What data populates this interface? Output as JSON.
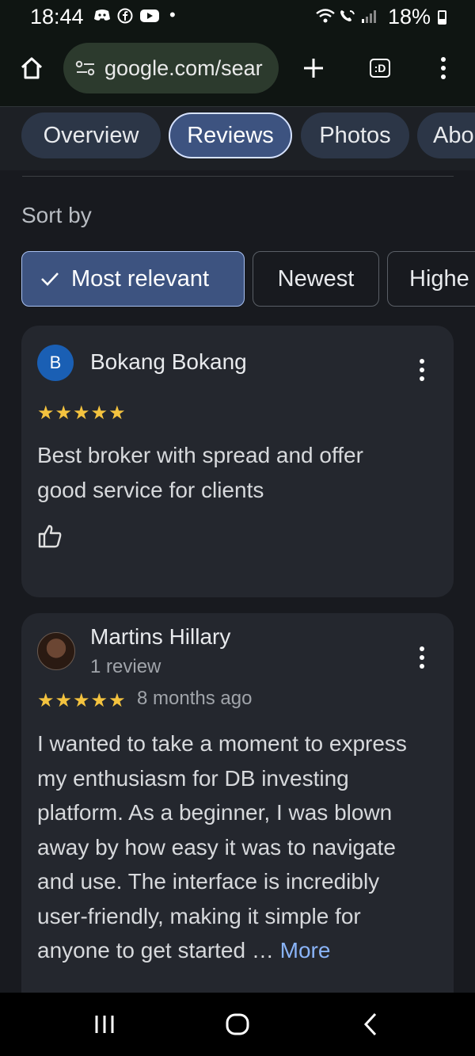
{
  "status_bar": {
    "time": "18:44",
    "battery_percent": "18%"
  },
  "browser": {
    "url": "google.com/sear",
    "tab_count": ":D"
  },
  "tabs": [
    {
      "label": "Overview",
      "active": false
    },
    {
      "label": "Reviews",
      "active": true
    },
    {
      "label": "Photos",
      "active": false
    },
    {
      "label": "Abo",
      "active": false
    }
  ],
  "sort": {
    "label": "Sort by",
    "options": [
      {
        "label": "Most relevant",
        "selected": true
      },
      {
        "label": "Newest",
        "selected": false
      },
      {
        "label": "Highe",
        "selected": false
      }
    ]
  },
  "reviews": [
    {
      "author": "Bokang Bokang",
      "avatar_letter": "B",
      "rating": 5,
      "stars": "★★★★★",
      "text_lines": [
        "Best broker with spread and offer",
        "good service for clients"
      ]
    },
    {
      "author": "Martins Hillary",
      "review_count": "1 review",
      "rating": 5,
      "stars": "★★★★★",
      "date": "8 months ago",
      "text_lines": [
        "I wanted to take a moment to express",
        "my enthusiasm for DB investing",
        "platform. As a beginner, I was blown",
        "away by how easy it was to navigate",
        "and use. The interface is incredibly",
        "user-friendly, making it simple for",
        "anyone to get started …"
      ],
      "more_label": "More"
    }
  ],
  "colors": {
    "accent_blue": "#3d5380",
    "star_yellow": "#f4c33f",
    "link_blue": "#8ab4f8"
  }
}
